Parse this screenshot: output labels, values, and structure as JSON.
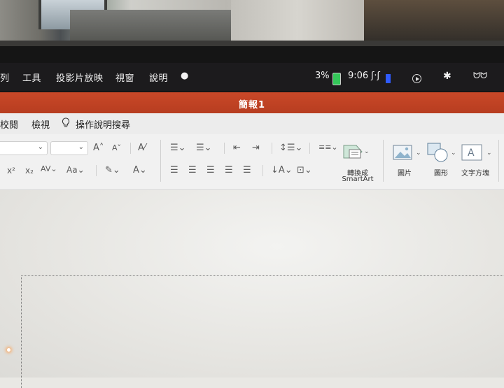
{
  "menubar": {
    "items": [
      "列",
      "工具",
      "投影片放映",
      "視窗",
      "說明"
    ],
    "battery": "3%",
    "time": "9:06"
  },
  "window": {
    "title": "簡報1"
  },
  "tabs": [
    "校閱",
    "檢視",
    "操作說明搜尋"
  ],
  "ribbon": {
    "convert_smartart": "轉換成",
    "convert_smartart_2": "SmartArt",
    "picture": "圖片",
    "shapes": "圖形",
    "textbox": "文字方塊"
  },
  "colors": {
    "title_bar": "#c94828",
    "menubar": "#1c1b1d",
    "battery": "#34c759"
  }
}
